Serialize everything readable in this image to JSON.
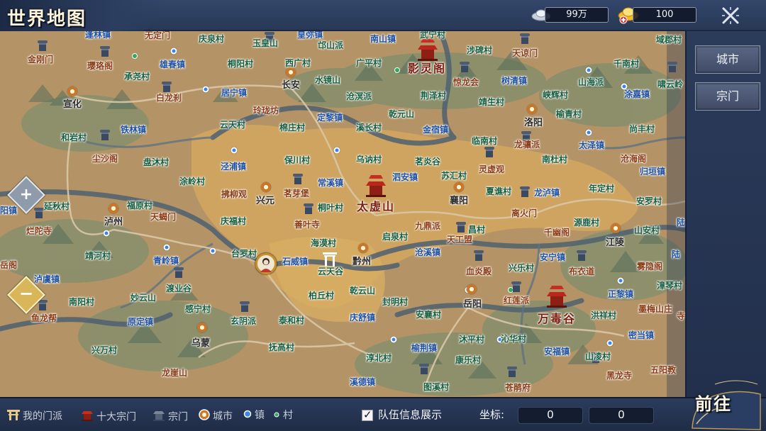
{
  "header": {
    "title": "世界地图",
    "silver": "99万",
    "gold": "100"
  },
  "side_tabs": {
    "city": "城市",
    "sect": "宗门"
  },
  "legend": {
    "my_sect": "我的门派",
    "top_ten": "十大宗门",
    "sect": "宗门",
    "city": "城市",
    "town": "镇",
    "village": "村"
  },
  "team_info": {
    "label": "队伍信息展示",
    "checked": true
  },
  "coords": {
    "label": "坐标:",
    "x": "0",
    "y": "0"
  },
  "go_button": "前往",
  "zoom": {
    "in": "+",
    "out": "−"
  },
  "colors": {
    "city_label": "#8a3a12",
    "sect_label": "#165d3f",
    "town_label": "#1e4fa0",
    "map_land": "#b49466",
    "map_plain": "#d2a75f",
    "river": "#506271",
    "ui_panel": "#2b3b5a"
  },
  "map_labels": [
    {
      "t": "逢林镇",
      "c": "b"
    },
    {
      "t": "无定门",
      "c": "t"
    },
    {
      "t": "庆泉村",
      "c": "c"
    },
    {
      "t": "皇弥镇",
      "c": "b"
    },
    {
      "t": "南山镇",
      "c": "b"
    },
    {
      "t": "武宁村",
      "c": "c"
    },
    {
      "t": "域郡村",
      "c": "c"
    },
    {
      "t": "金刚门",
      "c": "t"
    },
    {
      "t": "玉皇山",
      "c": "c"
    },
    {
      "t": "邙山派",
      "c": "c"
    },
    {
      "t": "涉碑村",
      "c": "c"
    },
    {
      "t": "天谅门",
      "c": "t"
    },
    {
      "t": "璎珞阁",
      "c": "t"
    },
    {
      "t": "雄春镇",
      "c": "b"
    },
    {
      "t": "桐阳村",
      "c": "c"
    },
    {
      "t": "西广村",
      "c": "c"
    },
    {
      "t": "广平村",
      "c": "c"
    },
    {
      "t": "影灵阁",
      "c": "s"
    },
    {
      "t": "千南村",
      "c": "c"
    },
    {
      "t": "承尧村",
      "c": "c"
    },
    {
      "t": "水镜山",
      "c": "c"
    },
    {
      "t": "惊龙会",
      "c": "t"
    },
    {
      "t": "树清镇",
      "c": "b"
    },
    {
      "t": "山海派",
      "c": "c"
    },
    {
      "t": "啸云岭",
      "c": "c"
    },
    {
      "t": "宣化",
      "c": "k"
    },
    {
      "t": "白龙刹",
      "c": "t"
    },
    {
      "t": "居宁镇",
      "c": "b"
    },
    {
      "t": "长安",
      "c": "k"
    },
    {
      "t": "沧溟派",
      "c": "c"
    },
    {
      "t": "荆泽村",
      "c": "c"
    },
    {
      "t": "峡辉村",
      "c": "c"
    },
    {
      "t": "涂嘉镇",
      "c": "b"
    },
    {
      "t": "玲珑坊",
      "c": "t"
    },
    {
      "t": "定黎镇",
      "c": "b"
    },
    {
      "t": "乾元山",
      "c": "c"
    },
    {
      "t": "靖生村",
      "c": "c"
    },
    {
      "t": "榆青村",
      "c": "c"
    },
    {
      "t": "铁林镇",
      "c": "b"
    },
    {
      "t": "云天村",
      "c": "c"
    },
    {
      "t": "棉庄村",
      "c": "c"
    },
    {
      "t": "溪长村",
      "c": "c"
    },
    {
      "t": "金宿镇",
      "c": "b"
    },
    {
      "t": "洛阳",
      "c": "k"
    },
    {
      "t": "尚丰村",
      "c": "c"
    },
    {
      "t": "和岩村",
      "c": "c"
    },
    {
      "t": "临南村",
      "c": "c"
    },
    {
      "t": "龙骧派",
      "c": "t"
    },
    {
      "t": "太泽镇",
      "c": "b"
    },
    {
      "t": "尘沙阁",
      "c": "t"
    },
    {
      "t": "盘沐村",
      "c": "c"
    },
    {
      "t": "泾浦镇",
      "c": "b"
    },
    {
      "t": "保川村",
      "c": "c"
    },
    {
      "t": "乌讷村",
      "c": "c"
    },
    {
      "t": "茗炎谷",
      "c": "c"
    },
    {
      "t": "灵虚观",
      "c": "t"
    },
    {
      "t": "南杜村",
      "c": "c"
    },
    {
      "t": "沧海阁",
      "c": "t"
    },
    {
      "t": "归垣镇",
      "c": "b"
    },
    {
      "t": "涂岭村",
      "c": "c"
    },
    {
      "t": "常溪镇",
      "c": "b"
    },
    {
      "t": "泗安镇",
      "c": "b"
    },
    {
      "t": "苏汇村",
      "c": "c"
    },
    {
      "t": "拂柳观",
      "c": "t"
    },
    {
      "t": "兴元",
      "c": "k"
    },
    {
      "t": "茗芽堡",
      "c": "t"
    },
    {
      "t": "太虚山",
      "c": "s"
    },
    {
      "t": "夏谯村",
      "c": "c"
    },
    {
      "t": "龙泸镇",
      "c": "b"
    },
    {
      "t": "年定村",
      "c": "c"
    },
    {
      "t": "延秋村",
      "c": "c"
    },
    {
      "t": "福原村",
      "c": "c"
    },
    {
      "t": "襄阳",
      "c": "k"
    },
    {
      "t": "安罗村",
      "c": "c"
    },
    {
      "t": "阳镇",
      "c": "b"
    },
    {
      "t": "天蝎门",
      "c": "t"
    },
    {
      "t": "桐叶村",
      "c": "c"
    },
    {
      "t": "离火门",
      "c": "t"
    },
    {
      "t": "泸州",
      "c": "k"
    },
    {
      "t": "庆福村",
      "c": "c"
    },
    {
      "t": "善叶寺",
      "c": "t"
    },
    {
      "t": "源鹿村",
      "c": "c"
    },
    {
      "t": "烂陀寺",
      "c": "t"
    },
    {
      "t": "九鼎派",
      "c": "t"
    },
    {
      "t": "昌村",
      "c": "c"
    },
    {
      "t": "千幽阁",
      "c": "t"
    },
    {
      "t": "山安村",
      "c": "c"
    },
    {
      "t": "启泉村",
      "c": "c"
    },
    {
      "t": "天工盟",
      "c": "t"
    },
    {
      "t": "海漠村",
      "c": "c"
    },
    {
      "t": "江陵",
      "c": "k"
    },
    {
      "t": "靖河村",
      "c": "c"
    },
    {
      "t": "台罗村",
      "c": "c"
    },
    {
      "t": "沧溪镇",
      "c": "b"
    },
    {
      "t": "安宁镇",
      "c": "b"
    },
    {
      "t": "陆",
      "c": "b"
    },
    {
      "t": "青岭镇",
      "c": "b"
    },
    {
      "t": "石威镇",
      "c": "b"
    },
    {
      "t": "黔州",
      "c": "k"
    },
    {
      "t": "兴乐村",
      "c": "c"
    },
    {
      "t": "雾隐阁",
      "c": "t"
    },
    {
      "t": "云天谷",
      "c": "c"
    },
    {
      "t": "血炎殿",
      "c": "t"
    },
    {
      "t": "布衣道",
      "c": "t"
    },
    {
      "t": "泸虞镇",
      "c": "b"
    },
    {
      "t": "渡业谷",
      "c": "c"
    },
    {
      "t": "漳琴村",
      "c": "c"
    },
    {
      "t": "妙云山",
      "c": "c"
    },
    {
      "t": "柏丘村",
      "c": "c"
    },
    {
      "t": "乾云山",
      "c": "c"
    },
    {
      "t": "红莲派",
      "c": "t"
    },
    {
      "t": "正黎镇",
      "c": "b"
    },
    {
      "t": "南阳村",
      "c": "c"
    },
    {
      "t": "感宁村",
      "c": "c"
    },
    {
      "t": "封明村",
      "c": "c"
    },
    {
      "t": "岳阳",
      "c": "k"
    },
    {
      "t": "万毒谷",
      "c": "s"
    },
    {
      "t": "墨梅山庄",
      "c": "t"
    },
    {
      "t": "原定镇",
      "c": "b"
    },
    {
      "t": "玄阴派",
      "c": "c"
    },
    {
      "t": "泰和村",
      "c": "c"
    },
    {
      "t": "庆舒镇",
      "c": "b"
    },
    {
      "t": "安襄村",
      "c": "c"
    },
    {
      "t": "洪祥村",
      "c": "c"
    },
    {
      "t": "沐平村",
      "c": "c"
    },
    {
      "t": "鱼龙帮",
      "c": "t"
    },
    {
      "t": "乌蒙",
      "c": "k"
    },
    {
      "t": "沁华村",
      "c": "c"
    },
    {
      "t": "密当镇",
      "c": "b"
    },
    {
      "t": "兴万村",
      "c": "c"
    },
    {
      "t": "抚高村",
      "c": "c"
    },
    {
      "t": "榆荆镇",
      "c": "b"
    },
    {
      "t": "安福镇",
      "c": "b"
    },
    {
      "t": "山凌村",
      "c": "c"
    },
    {
      "t": "龙崖山",
      "c": "t"
    },
    {
      "t": "淳北村",
      "c": "c"
    },
    {
      "t": "康乐村",
      "c": "c"
    },
    {
      "t": "黑龙寺",
      "c": "t"
    },
    {
      "t": "五阳教",
      "c": "t"
    },
    {
      "t": "溪德镇",
      "c": "b"
    },
    {
      "t": "图溪村",
      "c": "c"
    },
    {
      "t": "苍鹃府",
      "c": "t"
    },
    {
      "t": "太岳阁",
      "c": "t"
    },
    {
      "t": "寺",
      "c": "t"
    },
    {
      "t": "陆",
      "c": "b"
    },
    {
      "t": "天",
      "c": "t"
    }
  ]
}
